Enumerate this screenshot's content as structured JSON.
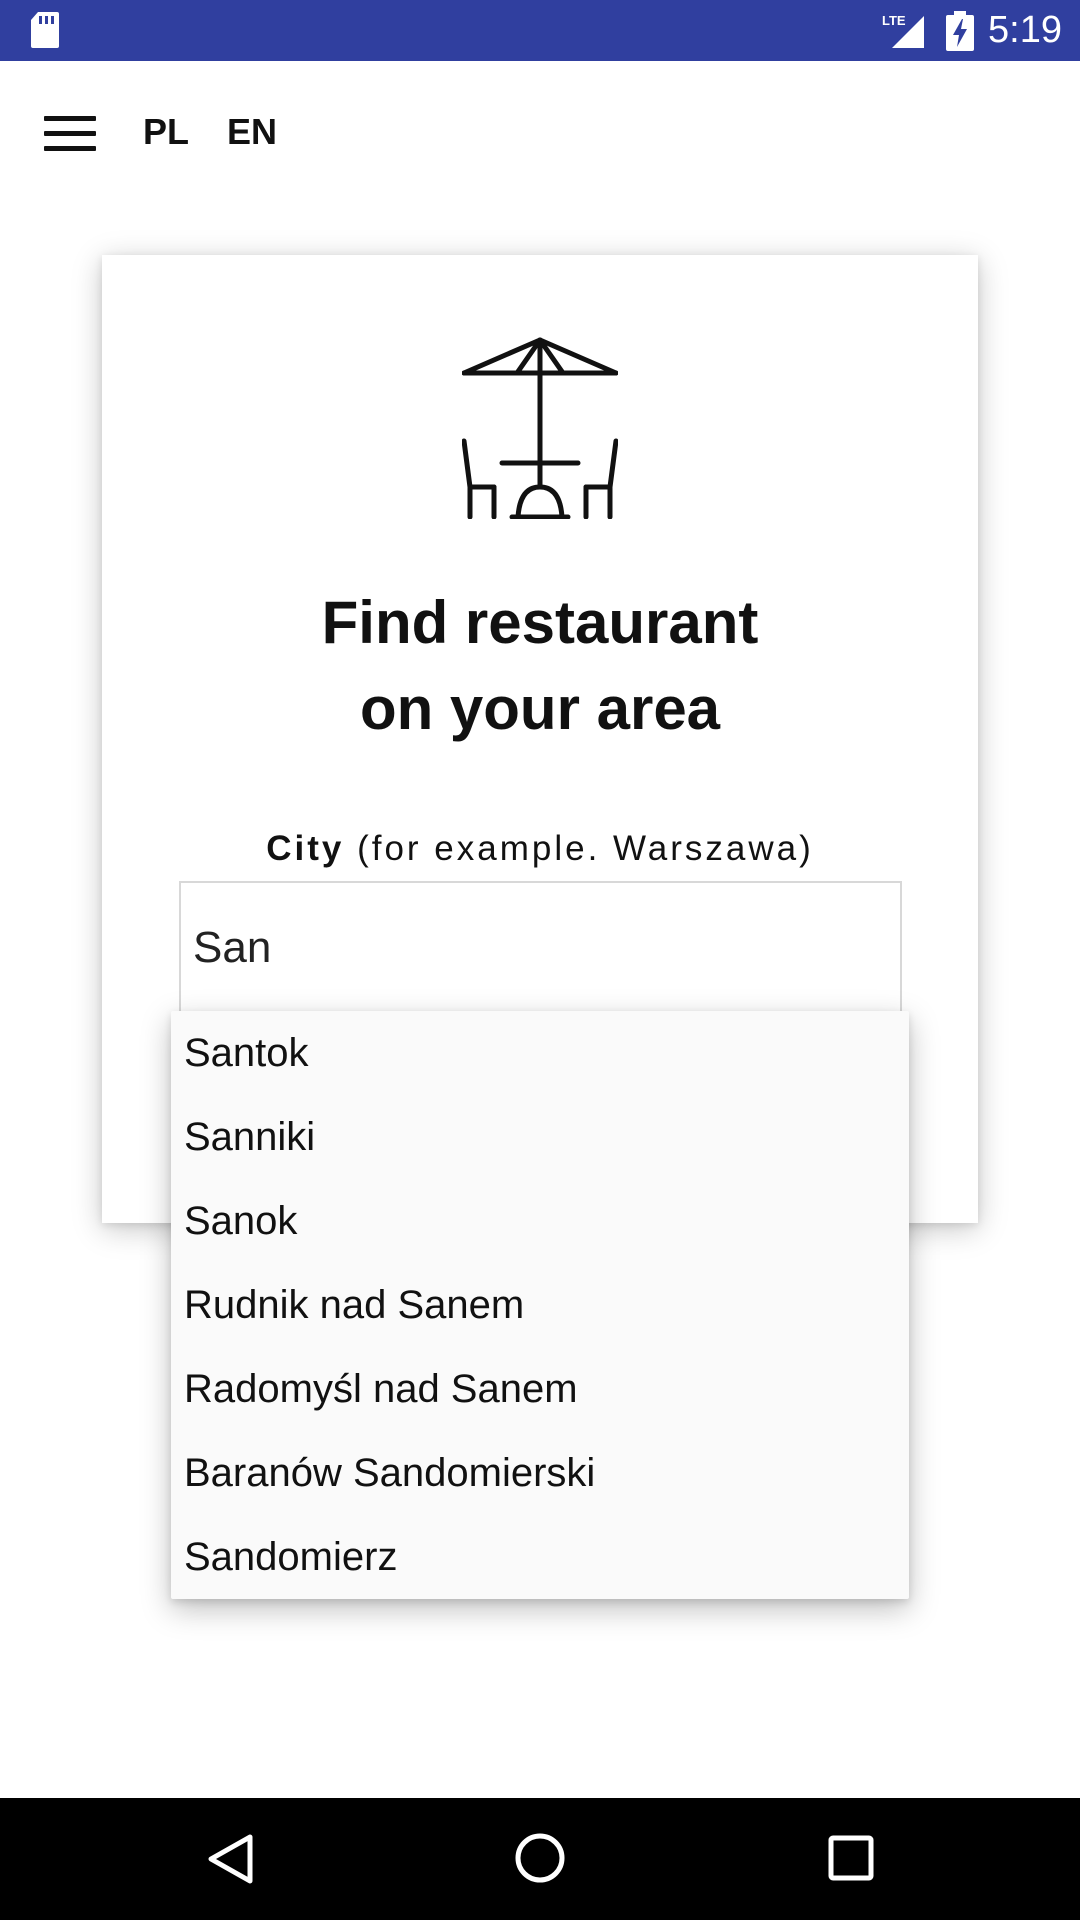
{
  "status_bar": {
    "time": "5:19",
    "network": "LTE",
    "icons": [
      "sd-card-icon",
      "lte-signal-icon",
      "battery-charging-icon"
    ],
    "background": "#303f9f"
  },
  "top_bar": {
    "menu_icon": "hamburger-menu-icon",
    "lang_pl": "PL",
    "lang_en": "EN"
  },
  "card": {
    "icon": "restaurant-umbrella-table-icon",
    "title_line1": "Find restaurant",
    "title_line2": "on your area",
    "city_label_bold": "City",
    "city_label_hint": " (for example. Warszawa)",
    "city_input_value": "San"
  },
  "dropdown": {
    "items": [
      "Santok",
      "Sanniki",
      "Sanok",
      "Rudnik nad Sanem",
      "Radomyśl nad Sanem",
      "Baranów Sandomierski",
      "Sandomierz"
    ]
  },
  "nav_bar": {
    "icons": [
      "back-icon",
      "home-icon",
      "recent-apps-icon"
    ]
  }
}
